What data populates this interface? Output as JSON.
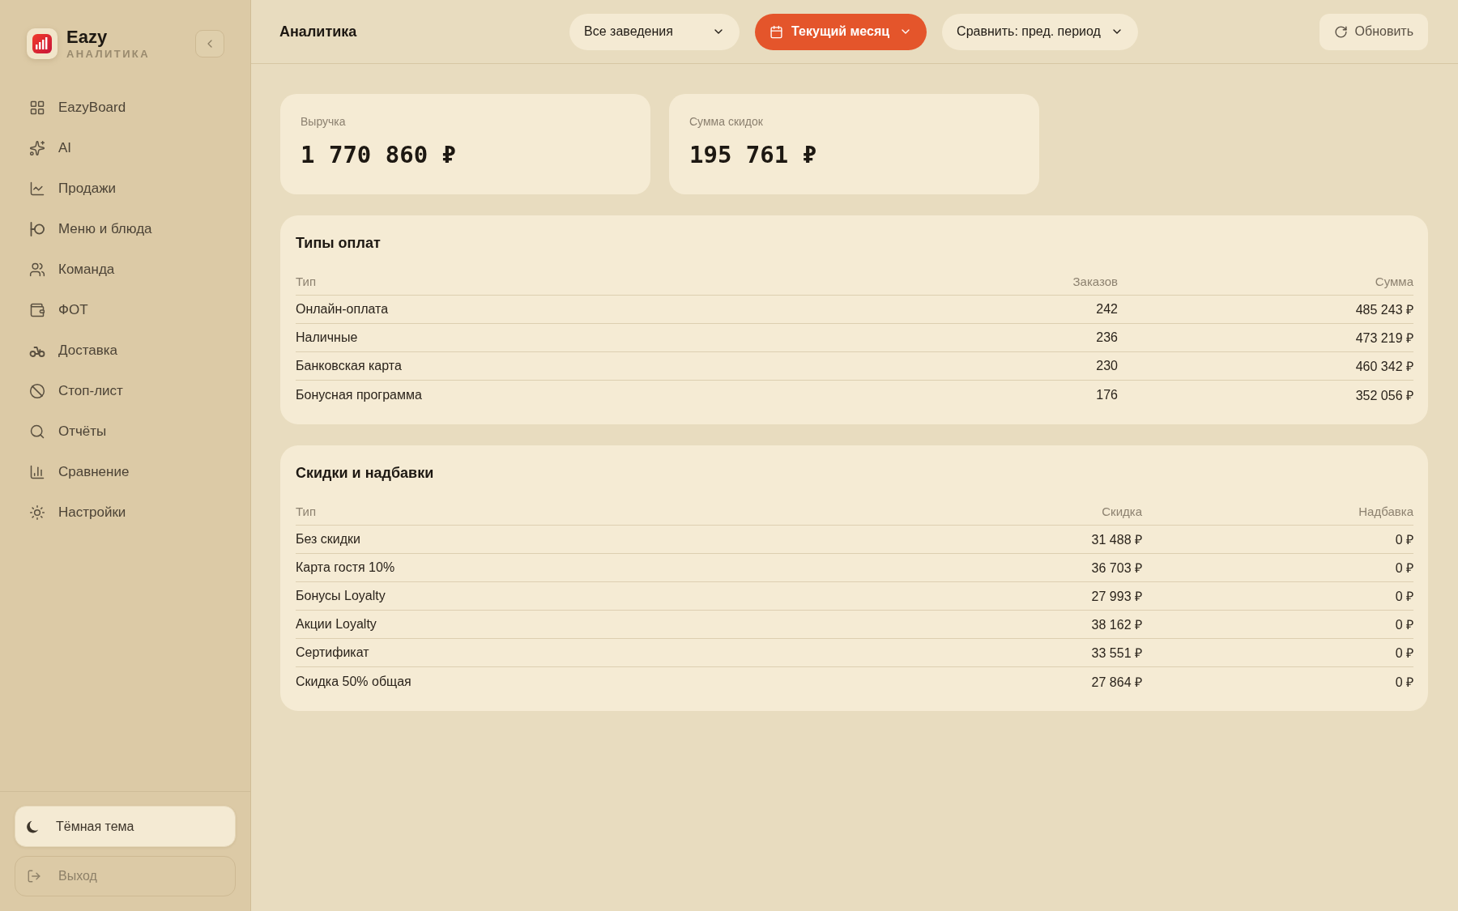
{
  "sidebar": {
    "brand": {
      "name": "Eazy",
      "subtitle": "АНАЛИТИКА"
    },
    "items": [
      {
        "label": "EazyBoard",
        "selected": false
      },
      {
        "label": "AI",
        "selected": false
      },
      {
        "label": "Продажи",
        "selected": false
      },
      {
        "label": "Меню и блюда",
        "selected": false
      },
      {
        "label": "Команда",
        "selected": false
      },
      {
        "label": "ФОТ",
        "selected": false
      },
      {
        "label": "Доставка",
        "selected": false
      },
      {
        "label": "Стоп-лист",
        "selected": false
      },
      {
        "label": "Отчёты",
        "selected": false
      },
      {
        "label": "Сравнение",
        "selected": false
      },
      {
        "label": "Настройки",
        "selected": false
      }
    ],
    "theme_button": "Тёмная тема",
    "logout_button": "Выход"
  },
  "header": {
    "title": "Аналитика",
    "filters": [
      {
        "label": "Все заведения",
        "kind": "select",
        "active": false
      },
      {
        "label": "Текущий месяц",
        "kind": "period",
        "active": true
      },
      {
        "label": "Сравнить: пред. период",
        "kind": "select",
        "active": false
      }
    ],
    "refresh_button": "Обновить"
  },
  "metrics": [
    {
      "label": "Выручка",
      "value": "1 770 860 ₽"
    },
    {
      "label": "Сумма скидок",
      "value": "195 761 ₽"
    }
  ],
  "tables": [
    {
      "title": "Типы оплат",
      "columns": [
        "Тип",
        "Заказов",
        "Сумма"
      ],
      "rows": [
        [
          "Онлайн-оплата",
          "242",
          "485 243 ₽"
        ],
        [
          "Наличные",
          "236",
          "473 219 ₽"
        ],
        [
          "Банковская карта",
          "230",
          "460 342 ₽"
        ],
        [
          "Бонусная программа",
          "176",
          "352 056 ₽"
        ]
      ]
    },
    {
      "title": "Скидки и надбавки",
      "columns": [
        "Тип",
        "Скидка",
        "Надбавка"
      ],
      "rows": [
        [
          "Без скидки",
          "31 488 ₽",
          "0 ₽"
        ],
        [
          "Карта гостя 10%",
          "36 703 ₽",
          "0 ₽"
        ],
        [
          "Бонусы Loyalty",
          "27 993 ₽",
          "0 ₽"
        ],
        [
          "Акции Loyalty",
          "38 162 ₽",
          "0 ₽"
        ],
        [
          "Сертификат",
          "33 551 ₽",
          "0 ₽"
        ],
        [
          "Скидка 50% общая",
          "27 864 ₽",
          "0 ₽"
        ]
      ]
    }
  ]
}
